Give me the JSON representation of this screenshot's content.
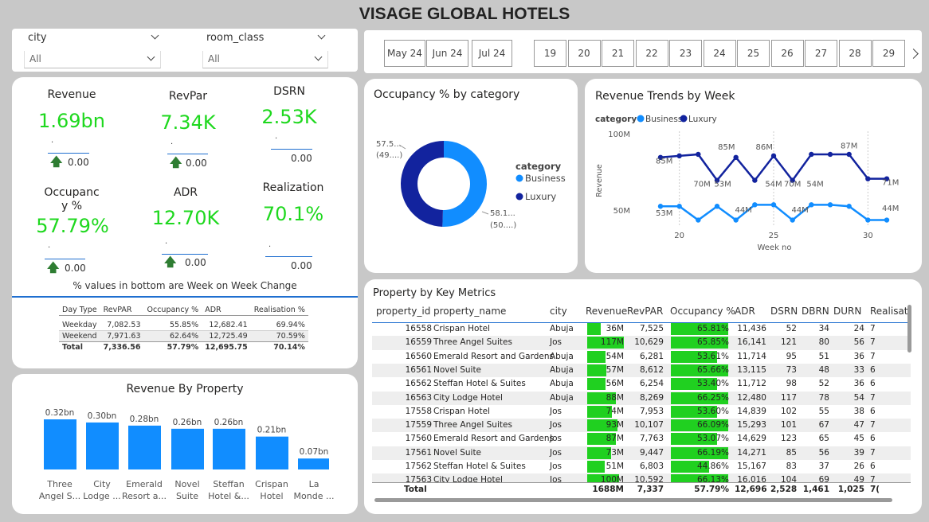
{
  "title": "VISAGE GLOBAL HOTELS",
  "slicers": [
    {
      "label": "city",
      "value": "All"
    },
    {
      "label": "room_class",
      "value": "All"
    }
  ],
  "months": [
    "May 24",
    "Jun 24",
    "Jul 24"
  ],
  "weeks": [
    "19",
    "20",
    "21",
    "22",
    "23",
    "24",
    "25",
    "26",
    "27",
    "28",
    "29"
  ],
  "kpis": [
    {
      "label": "Revenue",
      "value": "1.69bn",
      "dot": ".",
      "change": "0.00"
    },
    {
      "label": "RevPar",
      "value": "7.34K",
      "dot": ".",
      "change": "0.00"
    },
    {
      "label": "DSRN",
      "value": "2.53K",
      "dot": ".",
      "change": "0.00"
    },
    {
      "label": "Occupanc y %",
      "value": "57.79%",
      "dot": ".",
      "change": "0.00"
    },
    {
      "label": "ADR",
      "value": "12.70K",
      "dot": ".",
      "change": "0.00"
    },
    {
      "label": "Realization",
      "value": "70.1%",
      "dot": ".",
      "change": "0.00"
    }
  ],
  "kpi_note": "% values in bottom are Week on Week Change",
  "daytype_table": {
    "headers": [
      "Day Type",
      "RevPAR",
      "Occupancy %",
      "ADR",
      "Realisation %"
    ],
    "rows": [
      [
        "Weekday",
        "7,082.53",
        "55.85%",
        "12,682.41",
        "69.94%"
      ],
      [
        "Weekend",
        "7,971.63",
        "62.64%",
        "12,725.49",
        "70.59%"
      ]
    ],
    "total": [
      "Total",
      "7,336.56",
      "57.79%",
      "12,695.75",
      "70.14%"
    ]
  },
  "revenue_by_property": {
    "title": "Revenue By Property",
    "chart_data": {
      "type": "bar",
      "categories": [
        "Three Angel S...",
        "City Lodge ...",
        "Emerald Resort a...",
        "Novel Suite",
        "Steffan Hotel &...",
        "Crispan Hotel",
        "La Monde ..."
      ],
      "values": [
        0.32,
        0.3,
        0.28,
        0.26,
        0.26,
        0.21,
        0.07
      ],
      "labels": [
        "0.32bn",
        "0.30bn",
        "0.28bn",
        "0.26bn",
        "0.26bn",
        "0.21bn",
        "0.07bn"
      ],
      "color": "#118dff"
    }
  },
  "occupancy_donut": {
    "title": "Occupancy % by category",
    "legend_title": "category",
    "chart_data": {
      "type": "pie",
      "series": [
        {
          "name": "Business",
          "value": 50,
          "label1": "58.1...",
          "label2": "(50....)",
          "color": "#118dff"
        },
        {
          "name": "Luxury",
          "value": 49,
          "label1": "57.5...",
          "label2": "(49....)",
          "color": "#12239e"
        }
      ]
    }
  },
  "revenue_trends": {
    "title": "Revenue Trends by Week",
    "legend_title": "category",
    "xlabel": "Week no",
    "ylabel": "Revenue",
    "y_ticks": [
      "100M",
      "50M"
    ],
    "x_ticks": [
      "20",
      "25",
      "30"
    ],
    "chart_data": {
      "type": "line",
      "x": [
        19,
        20,
        21,
        22,
        23,
        24,
        25,
        26,
        27,
        28,
        29,
        30,
        31
      ],
      "ylim": [
        40,
        105
      ],
      "series": [
        {
          "name": "Luxury",
          "color": "#12239e",
          "values": [
            85,
            86,
            87,
            70,
            85,
            70,
            86,
            70,
            87,
            87,
            87,
            71,
            71
          ]
        },
        {
          "name": "Business",
          "color": "#118dff",
          "values": [
            53,
            53,
            44,
            53,
            44,
            54,
            54,
            44,
            54,
            54,
            53,
            44,
            44
          ]
        }
      ],
      "annotations": [
        {
          "text": "85M",
          "x": 19.2,
          "y": 81
        },
        {
          "text": "85M",
          "x": 22.5,
          "y": 90
        },
        {
          "text": "86M",
          "x": 24.5,
          "y": 90
        },
        {
          "text": "87M",
          "x": 29,
          "y": 91
        },
        {
          "text": "70M",
          "x": 21.2,
          "y": 66
        },
        {
          "text": "53M",
          "x": 22.3,
          "y": 66
        },
        {
          "text": "54M",
          "x": 25,
          "y": 66
        },
        {
          "text": "70M",
          "x": 26,
          "y": 66
        },
        {
          "text": "54M",
          "x": 27.2,
          "y": 66
        },
        {
          "text": "71M",
          "x": 31.2,
          "y": 67
        },
        {
          "text": "53M",
          "x": 19.2,
          "y": 47
        },
        {
          "text": "44M",
          "x": 23.4,
          "y": 49
        },
        {
          "text": "44M",
          "x": 26.4,
          "y": 49
        },
        {
          "text": "44M",
          "x": 31.2,
          "y": 50
        }
      ]
    }
  },
  "property_table": {
    "title": "Property by Key Metrics",
    "headers": [
      "property_id",
      "property_name",
      "city",
      "Revenue",
      "RevPAR",
      "Occupancy %",
      "ADR",
      "DSRN",
      "DBRN",
      "DURN",
      "Realisat"
    ],
    "rows": [
      {
        "id": "16558",
        "name": "Crispan Hotel",
        "city": "Abuja",
        "revenue": "36M",
        "rev_frac": 0.36,
        "revpar": "7,525",
        "occ": "65.81%",
        "occ_frac": 0.98,
        "adr": "11,436",
        "dsrn": "52",
        "dbrn": "34",
        "durn": "24",
        "real": "7"
      },
      {
        "id": "16559",
        "name": "Three Angel Suites",
        "city": "Jos",
        "revenue": "117M",
        "rev_frac": 1.0,
        "revpar": "10,629",
        "occ": "65.85%",
        "occ_frac": 0.98,
        "adr": "16,141",
        "dsrn": "121",
        "dbrn": "80",
        "durn": "56",
        "real": "7"
      },
      {
        "id": "16560",
        "name": "Emerald Resort and Gardens",
        "city": "Abuja",
        "revenue": "54M",
        "rev_frac": 0.5,
        "revpar": "6,281",
        "occ": "53.61%",
        "occ_frac": 0.8,
        "adr": "11,714",
        "dsrn": "95",
        "dbrn": "51",
        "durn": "36",
        "real": "7"
      },
      {
        "id": "16561",
        "name": "Novel Suite",
        "city": "Abuja",
        "revenue": "57M",
        "rev_frac": 0.52,
        "revpar": "8,612",
        "occ": "65.66%",
        "occ_frac": 0.98,
        "adr": "13,115",
        "dsrn": "73",
        "dbrn": "48",
        "durn": "33",
        "real": "6"
      },
      {
        "id": "16562",
        "name": "Steffan Hotel & Suites",
        "city": "Abuja",
        "revenue": "56M",
        "rev_frac": 0.51,
        "revpar": "6,254",
        "occ": "53.40%",
        "occ_frac": 0.8,
        "adr": "11,712",
        "dsrn": "98",
        "dbrn": "52",
        "durn": "36",
        "real": "6"
      },
      {
        "id": "16563",
        "name": "City Lodge Hotel",
        "city": "Abuja",
        "revenue": "88M",
        "rev_frac": 0.78,
        "revpar": "8,269",
        "occ": "66.25%",
        "occ_frac": 0.99,
        "adr": "12,480",
        "dsrn": "117",
        "dbrn": "78",
        "durn": "54",
        "real": "7"
      },
      {
        "id": "17558",
        "name": "Crispan Hotel",
        "city": "Jos",
        "revenue": "74M",
        "rev_frac": 0.67,
        "revpar": "7,953",
        "occ": "53.60%",
        "occ_frac": 0.8,
        "adr": "14,839",
        "dsrn": "102",
        "dbrn": "55",
        "durn": "38",
        "real": "6"
      },
      {
        "id": "17559",
        "name": "Three Angel Suites",
        "city": "Jos",
        "revenue": "93M",
        "rev_frac": 0.82,
        "revpar": "10,107",
        "occ": "66.09%",
        "occ_frac": 0.99,
        "adr": "15,293",
        "dsrn": "101",
        "dbrn": "67",
        "durn": "47",
        "real": "7"
      },
      {
        "id": "17560",
        "name": "Emerald Resort and Gardens",
        "city": "Jos",
        "revenue": "87M",
        "rev_frac": 0.78,
        "revpar": "7,763",
        "occ": "53.07%",
        "occ_frac": 0.79,
        "adr": "14,629",
        "dsrn": "123",
        "dbrn": "65",
        "durn": "45",
        "real": "6"
      },
      {
        "id": "17561",
        "name": "Novel Suite",
        "city": "Jos",
        "revenue": "73M",
        "rev_frac": 0.66,
        "revpar": "9,447",
        "occ": "66.19%",
        "occ_frac": 0.99,
        "adr": "14,271",
        "dsrn": "85",
        "dbrn": "56",
        "durn": "39",
        "real": "7"
      },
      {
        "id": "17562",
        "name": "Steffan Hotel & Suites",
        "city": "Jos",
        "revenue": "51M",
        "rev_frac": 0.47,
        "revpar": "6,803",
        "occ": "44.86%",
        "occ_frac": 0.66,
        "adr": "15,167",
        "dsrn": "83",
        "dbrn": "37",
        "durn": "26",
        "real": "6"
      },
      {
        "id": "17563",
        "name": "City Lodge Hotel",
        "city": "Jos",
        "revenue": "100M",
        "rev_frac": 0.87,
        "revpar": "10,592",
        "occ": "66.13%",
        "occ_frac": 0.99,
        "adr": "16,016",
        "dsrn": "104",
        "dbrn": "69",
        "durn": "49",
        "real": "7"
      }
    ],
    "total": {
      "label": "Total",
      "revenue": "1688M",
      "revpar": "7,337",
      "occ": "57.79%",
      "adr": "12,696",
      "dsrn": "2,528",
      "dbrn": "1,461",
      "durn": "1,025",
      "real": "7("
    }
  }
}
